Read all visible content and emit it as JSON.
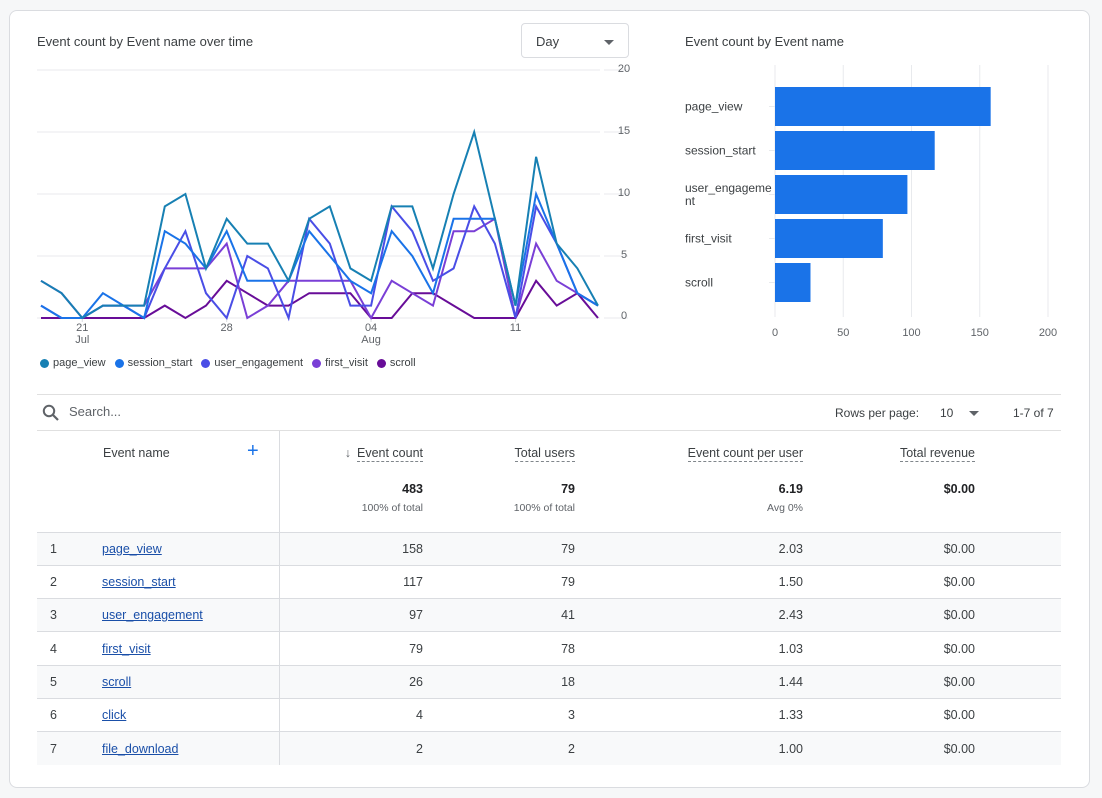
{
  "line_chart": {
    "title": "Event count by Event name over time",
    "granularity_select": {
      "value": "Day"
    }
  },
  "bar_chart": {
    "title": "Event count by Event name"
  },
  "chart_data": [
    {
      "type": "line",
      "title": "Event count by Event name over time",
      "x": [
        "Jul 19",
        "Jul 20",
        "Jul 21",
        "Jul 22",
        "Jul 23",
        "Jul 24",
        "Jul 25",
        "Jul 26",
        "Jul 27",
        "Jul 28",
        "Jul 29",
        "Jul 30",
        "Jul 31",
        "Aug 01",
        "Aug 02",
        "Aug 03",
        "Aug 04",
        "Aug 05",
        "Aug 06",
        "Aug 07",
        "Aug 08",
        "Aug 09",
        "Aug 10",
        "Aug 11",
        "Aug 12",
        "Aug 13",
        "Aug 14",
        "Aug 15"
      ],
      "x_ticks": [
        {
          "index": 2,
          "label": "21",
          "sublabel": "Jul"
        },
        {
          "index": 9,
          "label": "28",
          "sublabel": ""
        },
        {
          "index": 16,
          "label": "04",
          "sublabel": "Aug"
        },
        {
          "index": 23,
          "label": "11",
          "sublabel": ""
        }
      ],
      "y_ticks": [
        0,
        5,
        10,
        15,
        20
      ],
      "ylim": [
        0,
        20
      ],
      "y_axis_side": "right",
      "grid": true,
      "legend_position": "bottom-left",
      "series": [
        {
          "name": "page_view",
          "color": "#1780b3",
          "values": [
            3,
            2,
            0,
            1,
            1,
            1,
            9,
            10,
            4,
            8,
            6,
            6,
            3,
            8,
            9,
            4,
            3,
            9,
            9,
            4,
            10,
            15,
            8,
            1,
            13,
            6,
            4,
            1
          ]
        },
        {
          "name": "session_start",
          "color": "#1a73e8",
          "values": [
            1,
            0,
            0,
            2,
            1,
            0,
            7,
            6,
            4,
            7,
            3,
            3,
            3,
            7,
            5,
            3,
            2,
            7,
            5,
            2,
            8,
            8,
            8,
            1,
            10,
            6,
            2,
            1
          ]
        },
        {
          "name": "user_engagement",
          "color": "#4a4ee6",
          "values": [
            1,
            0,
            0,
            1,
            1,
            0,
            4,
            7,
            2,
            0,
            5,
            4,
            0,
            8,
            6,
            1,
            1,
            9,
            7,
            3,
            4,
            9,
            6,
            0,
            9,
            6,
            2,
            1
          ]
        },
        {
          "name": "first_visit",
          "color": "#7a3fd6",
          "values": [
            3,
            2,
            0,
            1,
            1,
            1,
            4,
            4,
            4,
            6,
            0,
            1,
            3,
            3,
            3,
            3,
            0,
            3,
            2,
            1,
            7,
            7,
            8,
            0,
            6,
            3,
            2,
            1
          ]
        },
        {
          "name": "scroll",
          "color": "#680d98",
          "values": [
            0,
            0,
            0,
            0,
            0,
            0,
            1,
            0,
            1,
            3,
            2,
            1,
            1,
            2,
            2,
            2,
            0,
            0,
            2,
            2,
            1,
            0,
            0,
            0,
            3,
            1,
            2,
            0
          ]
        }
      ]
    },
    {
      "type": "bar",
      "orientation": "horizontal",
      "title": "Event count by Event name",
      "categories": [
        "page_view",
        "session_start",
        "user_engagement",
        "first_visit",
        "scroll"
      ],
      "category_labels": [
        [
          "page_view"
        ],
        [
          "session_start"
        ],
        [
          "user_engageme",
          "nt"
        ],
        [
          "first_visit"
        ],
        [
          "scroll"
        ]
      ],
      "values": [
        158,
        117,
        97,
        79,
        26
      ],
      "x_ticks": [
        0,
        50,
        100,
        150,
        200
      ],
      "xlim": [
        0,
        200
      ],
      "bar_color": "#1a73e8",
      "grid": true
    }
  ],
  "table": {
    "search_placeholder": "Search...",
    "rows_per_page_label": "Rows per page:",
    "rows_per_page_value": "10",
    "pagination": "1-7 of 7",
    "columns": [
      {
        "label": "Event name"
      },
      {
        "label": "Event count",
        "sorted": "desc"
      },
      {
        "label": "Total users"
      },
      {
        "label": "Event count per user"
      },
      {
        "label": "Total revenue"
      }
    ],
    "totals": {
      "event_count": "483",
      "event_count_sub": "100% of total",
      "total_users": "79",
      "total_users_sub": "100% of total",
      "per_user": "6.19",
      "per_user_sub": "Avg 0%",
      "revenue": "$0.00"
    },
    "rows": [
      {
        "rank": "1",
        "name": "page_view",
        "count": "158",
        "users": "79",
        "per_user": "2.03",
        "revenue": "$0.00"
      },
      {
        "rank": "2",
        "name": "session_start",
        "count": "117",
        "users": "79",
        "per_user": "1.50",
        "revenue": "$0.00"
      },
      {
        "rank": "3",
        "name": "user_engagement",
        "count": "97",
        "users": "41",
        "per_user": "2.43",
        "revenue": "$0.00"
      },
      {
        "rank": "4",
        "name": "first_visit",
        "count": "79",
        "users": "78",
        "per_user": "1.03",
        "revenue": "$0.00"
      },
      {
        "rank": "5",
        "name": "scroll",
        "count": "26",
        "users": "18",
        "per_user": "1.44",
        "revenue": "$0.00"
      },
      {
        "rank": "6",
        "name": "click",
        "count": "4",
        "users": "3",
        "per_user": "1.33",
        "revenue": "$0.00"
      },
      {
        "rank": "7",
        "name": "file_download",
        "count": "2",
        "users": "2",
        "per_user": "1.00",
        "revenue": "$0.00"
      }
    ]
  }
}
